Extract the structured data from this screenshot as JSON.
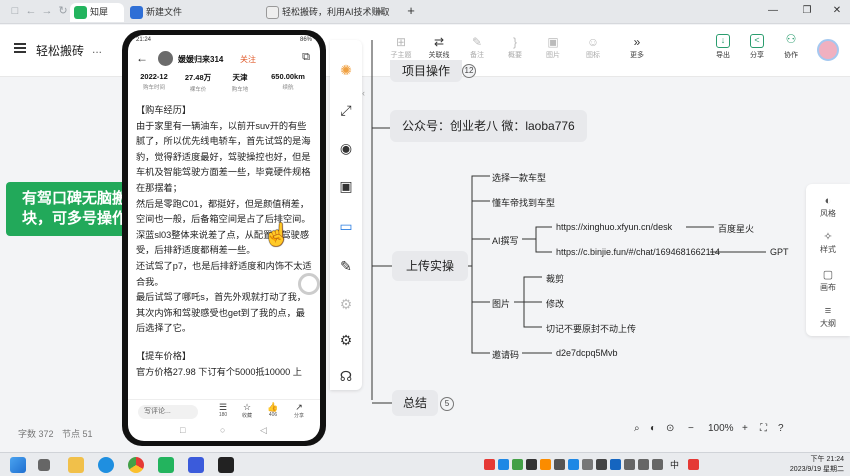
{
  "browser": {
    "tabs": [
      {
        "label": "知犀",
        "color": "#23b45e"
      },
      {
        "label": "新建文件",
        "color": "#2f6fd6"
      },
      {
        "label": "轻松搬砖，利用AI技术赚取百",
        "color": "#444444"
      }
    ],
    "new_tab": "+",
    "controls": {
      "minimize": "—",
      "maximize": "❐",
      "close": "✕"
    }
  },
  "appbar": {
    "doc_title": "轻松搬砖",
    "doc_title_dots": "...",
    "tools": [
      {
        "label": "子主题",
        "icon": "⊞"
      },
      {
        "label": "关联线",
        "icon": "⇄"
      },
      {
        "label": "备注",
        "icon": "✎"
      },
      {
        "label": "概要",
        "icon": "}"
      },
      {
        "label": "图片",
        "icon": "▣"
      },
      {
        "label": "图标",
        "icon": "☺"
      },
      {
        "label": "更多",
        "icon": "»"
      }
    ],
    "right_tools": [
      {
        "label": "导出",
        "icon": "↓"
      },
      {
        "label": "分享",
        "icon": "<"
      },
      {
        "label": "协作",
        "icon": "⚇"
      }
    ]
  },
  "banner": {
    "line1": "有驾口碑无脑搬",
    "line2": "块，可多号操作"
  },
  "mindmap": {
    "top_node": "项目操作",
    "top_badge": "12",
    "wechat_node": "公众号：创业老八  微：laoba776",
    "root": "上传实操",
    "branches": {
      "pick_car": "选择一款车型",
      "find_car": "懂车帝找到车型",
      "ai_write": "AI撰写",
      "ai_link1": "https://xinghuo.xfyun.cn/desk",
      "ai_link1_tag": "百度星火",
      "ai_link2": "https://c.binjie.fun/#/chat/1694681662114",
      "ai_link2_tag": "GPT",
      "image": "图片",
      "crop": "裁剪",
      "edit": "修改",
      "note": "切记不要原封不动上传",
      "invite": "邀请码",
      "invite_code": "d2e7dcpq5Mvb"
    },
    "summary": "总结",
    "summary_badge": "5"
  },
  "side_panel": [
    {
      "label": "风格",
      "icon": "◐"
    },
    {
      "label": "样式",
      "icon": "✧"
    },
    {
      "label": "画布",
      "icon": "▢"
    },
    {
      "label": "大纲",
      "icon": "≡"
    }
  ],
  "status": {
    "word_count": "字数 372",
    "node_count": "节点 51",
    "zoom": "100%"
  },
  "phone": {
    "status_time": "21:24",
    "status_right": "86%",
    "username": "媛媛归来314",
    "follow": "关注",
    "stats": [
      {
        "value": "2022-12",
        "key": "购车时间"
      },
      {
        "value": "27.48万",
        "key": "裸车价"
      },
      {
        "value": "天津",
        "key": "购车地"
      },
      {
        "value": "650.00km",
        "key": "续航"
      }
    ],
    "paragraphs": [
      "【购车经历】",
      "由于家里有一辆油车，以前开suv开的有些腻了，所以优先线电轿车，首先试驾的是海豹，觉得舒适度最好，驾驶操控也好，但是车机及智能驾驶方面差一些，毕竟硬件规格在那摆着；",
      "然后是零跑C01，都挺好，但是颜值稍差，空间也一般，后备箱空间是占了后排空间。",
      "深蓝sl03整体来说差了点，从配置，驾驶感受，后排舒适度都稍差一些。",
      "还试驾了p7，也是后排舒适度和内饰不太适合我。",
      "最后试驾了哪吒s，首先外观就打动了我，其次内饰和驾驶感受也get到了我的点，最后选择了它。",
      "",
      "【提车价格】",
      "官方价格27.98 下订有个5000抵10000 上"
    ],
    "comment_placeholder": "写评论...",
    "actions": [
      {
        "icon": "☰",
        "count": "180"
      },
      {
        "icon": "☆",
        "count": "收藏"
      },
      {
        "icon": "👍",
        "count": "406"
      },
      {
        "icon": "↗",
        "count": "分享"
      }
    ]
  },
  "taskbar": {
    "time": "下午 21:24",
    "date": "2023/9/19 星期二",
    "ime": "中"
  }
}
